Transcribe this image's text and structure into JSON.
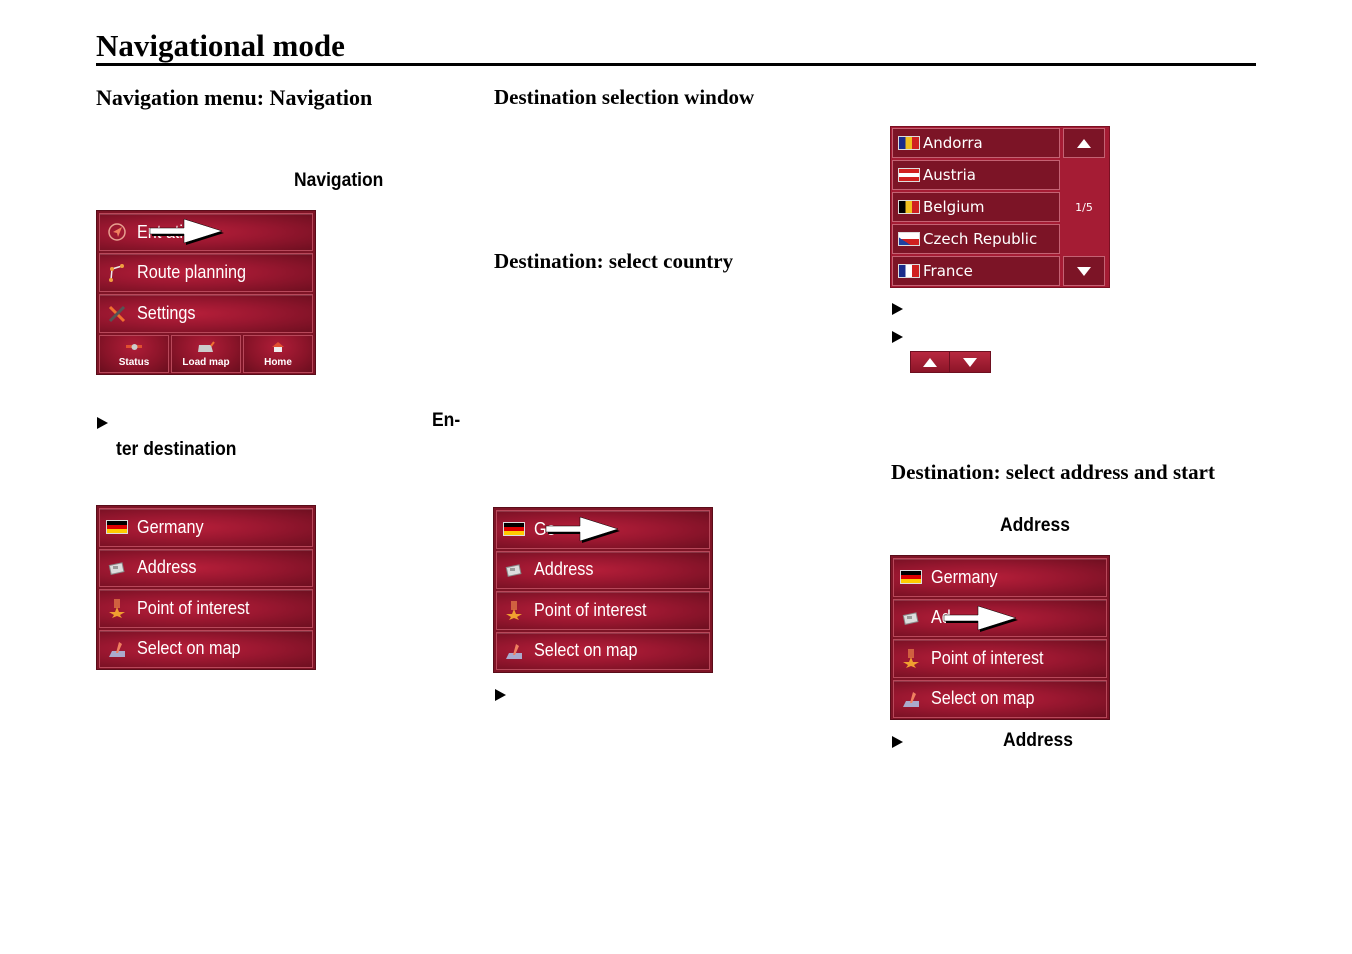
{
  "page": {
    "title": "Navigational mode"
  },
  "col1": {
    "heading": "Navigation menu: Navigation",
    "inline_bold": "Navigation",
    "nav_menu": {
      "items": [
        {
          "icon": "compass-arrow-icon",
          "label": "Enter destination",
          "visible_label": "Ent          ation"
        },
        {
          "icon": "route-icon",
          "label": "Route planning"
        },
        {
          "icon": "tools-icon",
          "label": "Settings"
        }
      ],
      "bottom_buttons": [
        {
          "icon": "satellite-icon",
          "label": "Status"
        },
        {
          "icon": "map-icon",
          "label": "Load map"
        },
        {
          "icon": "home-icon",
          "label": "Home"
        }
      ]
    },
    "step_bold_part1": "En-",
    "step_bold_part2": "ter destination",
    "dest_menu": {
      "items": [
        {
          "icon": "flag-germany-icon",
          "label": "Germany"
        },
        {
          "icon": "address-card-icon",
          "label": "Address"
        },
        {
          "icon": "poi-star-icon",
          "label": "Point of interest"
        },
        {
          "icon": "map-pin-icon",
          "label": "Select on map"
        }
      ]
    }
  },
  "col2": {
    "heading1": "Destination selection window",
    "heading2": "Destination: select country",
    "dest_menu": {
      "items": [
        {
          "icon": "flag-germany-icon",
          "label": "Germany",
          "visible_label": "Ge"
        },
        {
          "icon": "address-card-icon",
          "label": "Address"
        },
        {
          "icon": "poi-star-icon",
          "label": "Point of interest"
        },
        {
          "icon": "map-pin-icon",
          "label": "Select on map"
        }
      ]
    }
  },
  "col3": {
    "country_list": {
      "countries": [
        {
          "name": "Andorra",
          "flag": "flag-andorra-icon"
        },
        {
          "name": "Austria",
          "flag": "flag-austria-icon"
        },
        {
          "name": "Belgium",
          "flag": "flag-belgium-icon"
        },
        {
          "name": "Czech Republic",
          "flag": "flag-czech-icon"
        },
        {
          "name": "France",
          "flag": "flag-france-icon"
        }
      ],
      "page_indicator": "1/5"
    },
    "heading": "Destination: select address and start",
    "inline_bold": "Address",
    "dest_menu": {
      "items": [
        {
          "icon": "flag-germany-icon",
          "label": "Germany"
        },
        {
          "icon": "address-card-icon",
          "label": "Address",
          "visible_label": "Ad"
        },
        {
          "icon": "poi-star-icon",
          "label": "Point of interest"
        },
        {
          "icon": "map-pin-icon",
          "label": "Select on map"
        }
      ]
    },
    "step_bold": "Address"
  },
  "colors": {
    "panel_red": "#9a1730",
    "panel_dark": "#7e1426",
    "list_red": "#a51c34"
  }
}
